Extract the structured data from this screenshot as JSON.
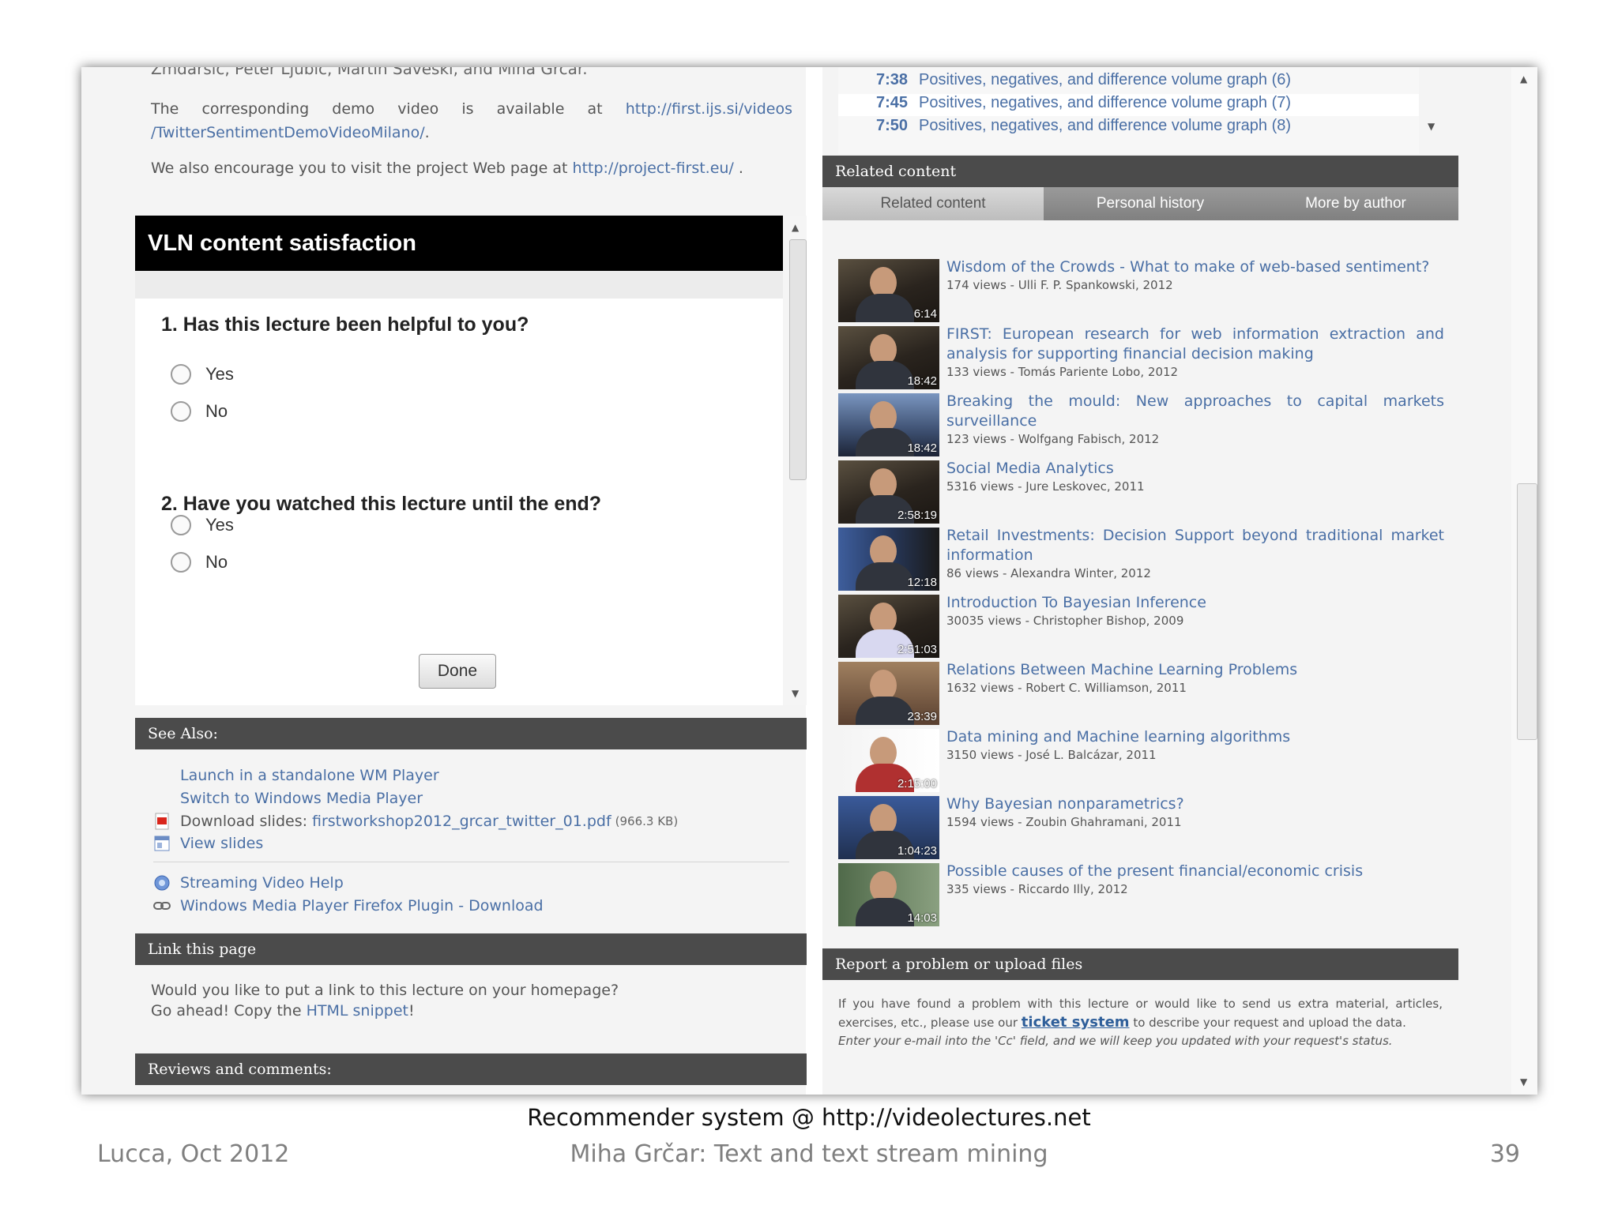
{
  "left": {
    "cut_text": "Zmdarsic, Peter Ljubic, Martin Saveski, and Miha Grcar.",
    "demo_text": "The corresponding demo video is available at",
    "demo_link": "http://first.ijs.si/videos /TwitterSentimentDemoVideoMilano/",
    "encourage_text": "We also encourage you to visit the project Web page at",
    "encourage_link": "http://project-first.eu/",
    "survey": {
      "title": "VLN content satisfaction",
      "q1": "1. Has this lecture been helpful to you?",
      "q2": "2. Have you watched this lecture until the end?",
      "yes": "Yes",
      "no": "No",
      "done": "Done"
    },
    "see_also": {
      "header": "See Also:",
      "launch": "Launch in a standalone WM Player",
      "switch": "Switch to Windows Media Player",
      "download_label": "Download slides:",
      "download_file": "firstworkshop2012_grcar_twitter_01.pdf",
      "download_size": "(966.3 KB)",
      "view": "View slides",
      "streaming_help": "Streaming Video Help",
      "plugin": "Windows Media Player Firefox Plugin - Download"
    },
    "link_page": {
      "header": "Link this page",
      "line1": "Would you like to put a link to this lecture on your homepage?",
      "line2_pre": "Go ahead! Copy the",
      "line2_link": "HTML snippet",
      "line2_post": "!"
    },
    "reviews_header": "Reviews and comments:"
  },
  "right": {
    "chapters": [
      {
        "time": "7:38",
        "title": "Positives, negatives, and difference volume graph (6)"
      },
      {
        "time": "7:45",
        "title": "Positives, negatives, and difference volume graph (7)"
      },
      {
        "time": "7:50",
        "title": "Positives, negatives, and difference volume graph (8)"
      }
    ],
    "related_header": "Related content",
    "tabs": [
      "Related content",
      "Personal history",
      "More by author"
    ],
    "items": [
      {
        "title": "Wisdom of the Crowds - What to make of web-based sentiment?",
        "meta": "174 views - Ulli F. P. Spankowski, 2012",
        "duration": "6:14"
      },
      {
        "title": "FIRST: European research for web information extraction and analysis for supporting financial decision making",
        "meta": "133 views - Tomás Pariente Lobo, 2012",
        "duration": "18:42"
      },
      {
        "title": "Breaking the mould: New approaches to capital markets surveillance",
        "meta": "123 views - Wolfgang Fabisch, 2012",
        "duration": "18:42"
      },
      {
        "title": "Social Media Analytics",
        "meta": "5316 views - Jure Leskovec, 2011",
        "duration": "2:58:19"
      },
      {
        "title": "Retail Investments: Decision Support beyond traditional market information",
        "meta": "86 views - Alexandra Winter, 2012",
        "duration": "12:18"
      },
      {
        "title": "Introduction To Bayesian Inference",
        "meta": "30035 views - Christopher Bishop, 2009",
        "duration": "2:51:03"
      },
      {
        "title": "Relations Between Machine Learning Problems",
        "meta": "1632 views - Robert C. Williamson, 2011",
        "duration": "23:39"
      },
      {
        "title": "Data mining and Machine learning algorithms",
        "meta": "3150 views - José L. Balcázar, 2011",
        "duration": "2:15:00"
      },
      {
        "title": "Why Bayesian nonparametrics?",
        "meta": "1594 views - Zoubin Ghahramani, 2011",
        "duration": "1:04:23"
      },
      {
        "title": "Possible causes of the present financial/economic crisis",
        "meta": "335 views - Riccardo Illy, 2012",
        "duration": "14:03"
      }
    ],
    "report": {
      "header": "Report a problem or upload files",
      "text_pre": "If you have found a problem with this lecture or would like to send us extra material, articles, exercises, etc., please use our",
      "link": "ticket system",
      "text_post": "to describe your request and upload the data.",
      "italic": "Enter your e-mail into the 'Cc' field, and we will keep you updated with your request's status."
    }
  },
  "slide": {
    "caption": "Recommender system @ http://videolectures.net",
    "left_footer": "Lucca, Oct 2012",
    "center_footer": "Miha Grčar: Text and text stream mining",
    "page_number": "39"
  },
  "colors": {
    "link": "#4a6fa5",
    "section_bar": "#4b4b4b",
    "survey_header": "#000000"
  }
}
